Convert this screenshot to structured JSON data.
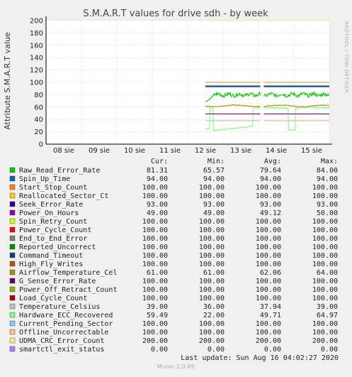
{
  "chart_data": {
    "type": "line",
    "title": "S.M.A.R.T values for drive sdh - by week",
    "ylabel": "Attribute S.M.A.R.T value",
    "ylim": [
      0,
      200
    ],
    "yticks": [
      0,
      20,
      40,
      60,
      80,
      100,
      120,
      140,
      160,
      180,
      200
    ],
    "xlim": [
      0,
      8
    ],
    "categories": [
      "08 sie",
      "09 sie",
      "10 sie",
      "11 sie",
      "12 sie",
      "13 sie",
      "14 sie",
      "15 sie"
    ],
    "data_start": 4.5,
    "gap": [
      6.05,
      6.15
    ],
    "side_label": "RRDTOOL / TOBI OETIKER",
    "grid": true,
    "columns": [
      "Cur:",
      "Min:",
      "Avg:",
      "Max:"
    ],
    "series": [
      {
        "name": "Raw_Read_Error_Rate",
        "color": "#00cc00",
        "cur": "81.31",
        "min": "65.57",
        "avg": "79.64",
        "max": "84.00",
        "level": 80,
        "pattern": "noisy"
      },
      {
        "name": "Spin_Up_Time",
        "color": "#0066b3",
        "cur": "94.00",
        "min": "94.00",
        "avg": "94.00",
        "max": "94.00",
        "level": 94,
        "pattern": "flat"
      },
      {
        "name": "Start_Stop_Count",
        "color": "#ff8000",
        "cur": "100.00",
        "min": "100.00",
        "avg": "100.00",
        "max": "100.00",
        "level": 100,
        "pattern": "flat"
      },
      {
        "name": "Reallocated_Sector_Ct",
        "color": "#ffcc00",
        "cur": "100.00",
        "min": "100.00",
        "avg": "100.00",
        "max": "100.00",
        "level": 100,
        "pattern": "flat"
      },
      {
        "name": "Seek_Error_Rate",
        "color": "#330099",
        "cur": "93.00",
        "min": "93.00",
        "avg": "93.00",
        "max": "93.00",
        "level": 93,
        "pattern": "flat"
      },
      {
        "name": "Power_On_Hours",
        "color": "#990099",
        "cur": "49.00",
        "min": "49.00",
        "avg": "49.12",
        "max": "50.00",
        "level": 49,
        "pattern": "flat"
      },
      {
        "name": "Spin_Retry_Count",
        "color": "#ccff00",
        "cur": "100.00",
        "min": "100.00",
        "avg": "100.00",
        "max": "100.00",
        "level": 100,
        "pattern": "flat"
      },
      {
        "name": "Power_Cycle_Count",
        "color": "#ff0000",
        "cur": "100.00",
        "min": "100.00",
        "avg": "100.00",
        "max": "100.00",
        "level": 100,
        "pattern": "flat"
      },
      {
        "name": "End_to_End_Error",
        "color": "#808080",
        "cur": "100.00",
        "min": "100.00",
        "avg": "100.00",
        "max": "100.00",
        "level": 100,
        "pattern": "flat"
      },
      {
        "name": "Reported_Uncorrect",
        "color": "#008f00",
        "cur": "100.00",
        "min": "100.00",
        "avg": "100.00",
        "max": "100.00",
        "level": 100,
        "pattern": "flat"
      },
      {
        "name": "Command_Timeout",
        "color": "#00487d",
        "cur": "100.00",
        "min": "100.00",
        "avg": "100.00",
        "max": "100.00",
        "level": 100,
        "pattern": "flat"
      },
      {
        "name": "High_Fly_Writes",
        "color": "#b35a00",
        "cur": "100.00",
        "min": "100.00",
        "avg": "100.00",
        "max": "100.00",
        "level": 100,
        "pattern": "flat"
      },
      {
        "name": "Airflow_Temperature_Cel",
        "color": "#b38f00",
        "cur": "61.00",
        "min": "61.00",
        "avg": "62.06",
        "max": "64.00",
        "level": 62,
        "pattern": "small"
      },
      {
        "name": "G_Sense_Error_Rate",
        "color": "#6b006b",
        "cur": "100.00",
        "min": "100.00",
        "avg": "100.00",
        "max": "100.00",
        "level": 100,
        "pattern": "flat"
      },
      {
        "name": "Power_Off_Retract_Count",
        "color": "#8fb300",
        "cur": "100.00",
        "min": "100.00",
        "avg": "100.00",
        "max": "100.00",
        "level": 100,
        "pattern": "flat"
      },
      {
        "name": "Load_Cycle_Count",
        "color": "#b30000",
        "cur": "100.00",
        "min": "100.00",
        "avg": "100.00",
        "max": "100.00",
        "level": 100,
        "pattern": "flat"
      },
      {
        "name": "Temperature_Celsius",
        "color": "#bebebe",
        "cur": "39.00",
        "min": "36.00",
        "avg": "37.94",
        "max": "39.00",
        "level": 38,
        "pattern": "flat"
      },
      {
        "name": "Hardware_ECC_Recovered",
        "color": "#80ff80",
        "cur": "59.49",
        "min": "22.00",
        "avg": "49.71",
        "max": "64.97",
        "level": 59,
        "pattern": "dips"
      },
      {
        "name": "Current_Pending_Sector",
        "color": "#80c9ff",
        "cur": "100.00",
        "min": "100.00",
        "avg": "100.00",
        "max": "100.00",
        "level": 100,
        "pattern": "flat"
      },
      {
        "name": "Offline_Uncorrectable",
        "color": "#ffc080",
        "cur": "100.00",
        "min": "100.00",
        "avg": "100.00",
        "max": "100.00",
        "level": 100,
        "pattern": "flat"
      },
      {
        "name": "UDMA_CRC_Error_Count",
        "color": "#ffe680",
        "cur": "200.00",
        "min": "200.00",
        "avg": "200.00",
        "max": "200.00",
        "level": 200,
        "pattern": "flat"
      },
      {
        "name": "smartctl_exit_status",
        "color": "#aa80ff",
        "cur": "0.00",
        "min": "0.00",
        "avg": "0.00",
        "max": "0.00",
        "level": 0,
        "pattern": "flat"
      }
    ]
  },
  "footer": {
    "last_update": "Last update: Sun Aug 16 04:02:27 2020",
    "generator": "Munin 2.0.49"
  }
}
